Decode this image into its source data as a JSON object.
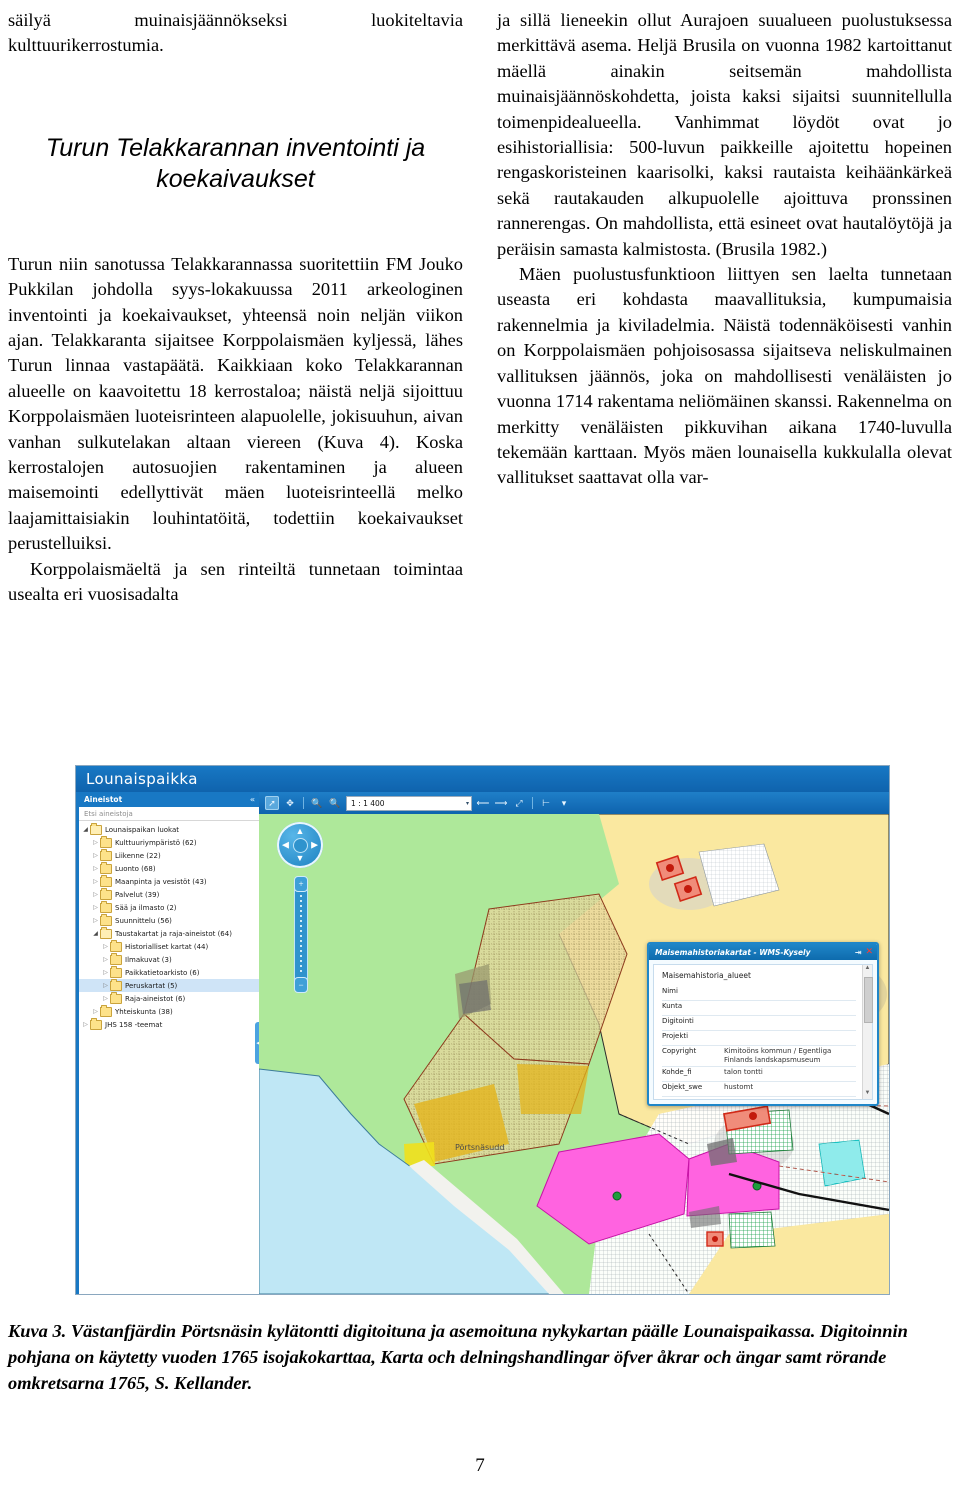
{
  "article": {
    "left_column": {
      "continued_paragraph": "säilyä muinaisjäännökseksi luokiteltavia kulttuurikerrostumia.",
      "title": "Turun Telakkarannan inventointi ja koekaivaukset",
      "paragraph_1": "Turun niin sanotussa Telakkarannassa suoritettiin FM Jouko Pukkilan johdolla syys-lokakuussa 2011 arkeologinen inventointi ja koekaivaukset, yhteensä noin neljän viikon ajan. Telakkaranta sijaitsee Korppolaismäen kyljessä, lähes Turun linnaa vastapäätä. Kaikkiaan koko Telakkarannan alueelle on kaavoitettu 18 kerrostaloa; näistä neljä sijoittuu Korppolaismäen luoteisrinteen alapuolelle, jokisuuhun, aivan vanhan sulkutelakan altaan viereen (Kuva 4). Koska kerrostalojen autosuojien rakentaminen ja alueen maisemointi edellyttivät mäen luoteisrinteellä melko laajamittaisiakin louhintatöitä, todettiin koekaivaukset perustelluiksi.",
      "paragraph_2": "Korppolaismäeltä ja sen rinteiltä tunnetaan toimintaa usealta eri vuosisadalta"
    },
    "right_column": {
      "paragraph_1": "ja sillä lieneekin ollut Aurajoen suualueen puolustuksessa merkittävä asema. Heljä Brusila on vuonna 1982 kartoittanut mäellä ainakin seitsemän mahdollista muinaisjäännöskohdetta, joista kaksi sijaitsi suunnitellulla toimenpidealueella. Vanhimmat löydöt ovat jo esihistoriallisia: 500-luvun paikkeille ajoitettu hopeinen rengaskoristeinen kaarisolki, kaksi rautaista keihäänkärkeä sekä rautakauden alkupuolelle ajoittuva pronssinen rannerengas. On mahdollista, että esineet ovat hautalöytöjä ja peräisin samasta kalmistosta. (Brusila 1982.)",
      "paragraph_2": "Mäen puolustusfunktioon liittyen sen laelta tunnetaan useasta eri kohdasta maavallituksia, kumpumaisia rakennelmia ja kiviladelmia. Näistä todennäköisesti vanhin on Korppolaismäen pohjoisosassa sijaitseva neliskulmainen vallituksen jäännös, joka on mahdollisesti venäläisten jo vuonna 1714 rakentama neliömäinen skanssi. Rakennelma on merkitty venäläisten pikkuvihan aikana 1740-luvulla tekemään karttaan. Myös mäen lounaisella kukkulalla olevat vallitukset saattavat olla var-"
    }
  },
  "figure": {
    "app": {
      "brand": "Lounaispaikka",
      "sidebar": {
        "title": "Aineistot",
        "collapse_icon": "«",
        "search_placeholder": "Etsi aineistoja",
        "tree": [
          {
            "label": "Lounaispaikan luokat",
            "indent": 1,
            "state": "open",
            "selected": false
          },
          {
            "label": "Kulttuuriympäristö (62)",
            "indent": 2,
            "state": "closed",
            "selected": false
          },
          {
            "label": "Liikenne (22)",
            "indent": 2,
            "state": "closed",
            "selected": false
          },
          {
            "label": "Luonto (68)",
            "indent": 2,
            "state": "closed",
            "selected": false
          },
          {
            "label": "Maanpinta ja vesistöt (43)",
            "indent": 2,
            "state": "closed",
            "selected": false
          },
          {
            "label": "Palvelut (39)",
            "indent": 2,
            "state": "closed",
            "selected": false
          },
          {
            "label": "Sää ja ilmasto (2)",
            "indent": 2,
            "state": "closed",
            "selected": false
          },
          {
            "label": "Suunnittelu (56)",
            "indent": 2,
            "state": "closed",
            "selected": false
          },
          {
            "label": "Taustakartat ja raja-aineistot (64)",
            "indent": 2,
            "state": "open",
            "selected": false
          },
          {
            "label": "Historialliset kartat (44)",
            "indent": 3,
            "state": "closed",
            "selected": false
          },
          {
            "label": "Ilmakuvat (3)",
            "indent": 3,
            "state": "closed",
            "selected": false
          },
          {
            "label": "Paikkatietoarkisto (6)",
            "indent": 3,
            "state": "closed",
            "selected": false
          },
          {
            "label": "Peruskartat (5)",
            "indent": 3,
            "state": "closed",
            "selected": true
          },
          {
            "label": "Raja-aineistot (6)",
            "indent": 3,
            "state": "closed",
            "selected": false
          },
          {
            "label": "Yhteiskunta (38)",
            "indent": 2,
            "state": "closed",
            "selected": false
          },
          {
            "label": "JHS 158 -teemat",
            "indent": 1,
            "state": "closed",
            "selected": false
          }
        ]
      },
      "toolbar": {
        "tools": [
          {
            "name": "pan-select-tool",
            "glyph": "➚",
            "active": true
          },
          {
            "name": "extent-tool",
            "glyph": "✥",
            "active": false
          },
          {
            "name": "zoom-in-tool",
            "glyph": "🔍",
            "active": false
          },
          {
            "name": "zoom-out-tool",
            "glyph": "🔍",
            "active": false
          }
        ],
        "scale_value": "1 : 1 400",
        "scale_caret": "▾",
        "right_tools": [
          {
            "name": "previous-extent-button",
            "glyph": "⟵"
          },
          {
            "name": "next-extent-button",
            "glyph": "⟶"
          },
          {
            "name": "full-extent-button",
            "glyph": "⤢"
          },
          {
            "name": "measure-tool",
            "glyph": "⊢"
          },
          {
            "name": "more-tools-button",
            "glyph": "▾"
          }
        ]
      },
      "map": {
        "navigation": {
          "up": "▲",
          "down": "▼",
          "left": "◀",
          "right": "▶",
          "zoom_in": "+",
          "zoom_out": "−"
        },
        "place_label": "Pörtsnäsudd"
      },
      "popup": {
        "title": "Maisemahistoriakartat - WMS-Kysely",
        "minimize_icon": "⇥",
        "close_icon": "✕",
        "layer_name": "Maisemahistoria_alueet",
        "rows": [
          {
            "key": "Nimi",
            "value": ""
          },
          {
            "key": "Kunta",
            "value": ""
          },
          {
            "key": "Digitointi",
            "value": ""
          },
          {
            "key": "Projekti",
            "value": ""
          },
          {
            "key": "Copyright",
            "value": "Kimitoöns kommun / Egentliga Finlands landskapsmuseum"
          },
          {
            "key": "Kohde_fi",
            "value": "talon tontti"
          },
          {
            "key": "Objekt_swe",
            "value": "hustomt"
          }
        ],
        "scroll_up_icon": "▲",
        "scroll_down_icon": "▼"
      }
    },
    "caption": "Kuva 3. Västanfjärdin Pörtsnäsin kylätontti digitoituna ja asemoituna nykykartan päälle Lounaispaikassa. Digitoinnin pohjana on käytetty vuoden 1765 isojakokarttaa, Karta och delningshandlingar öfver åkrar och ängar samt rörande omkretsarna 1765, S. Kellander."
  },
  "folio": "7",
  "colors": {
    "brand_blue": "#1878c4",
    "map_green": "#aee89a",
    "map_yellow": "#fae8a0",
    "map_magenta": "#ff63e0",
    "map_water": "#bfe7f5",
    "marker_red": "#e03a2f",
    "selection_blue": "#cfe4f7"
  }
}
